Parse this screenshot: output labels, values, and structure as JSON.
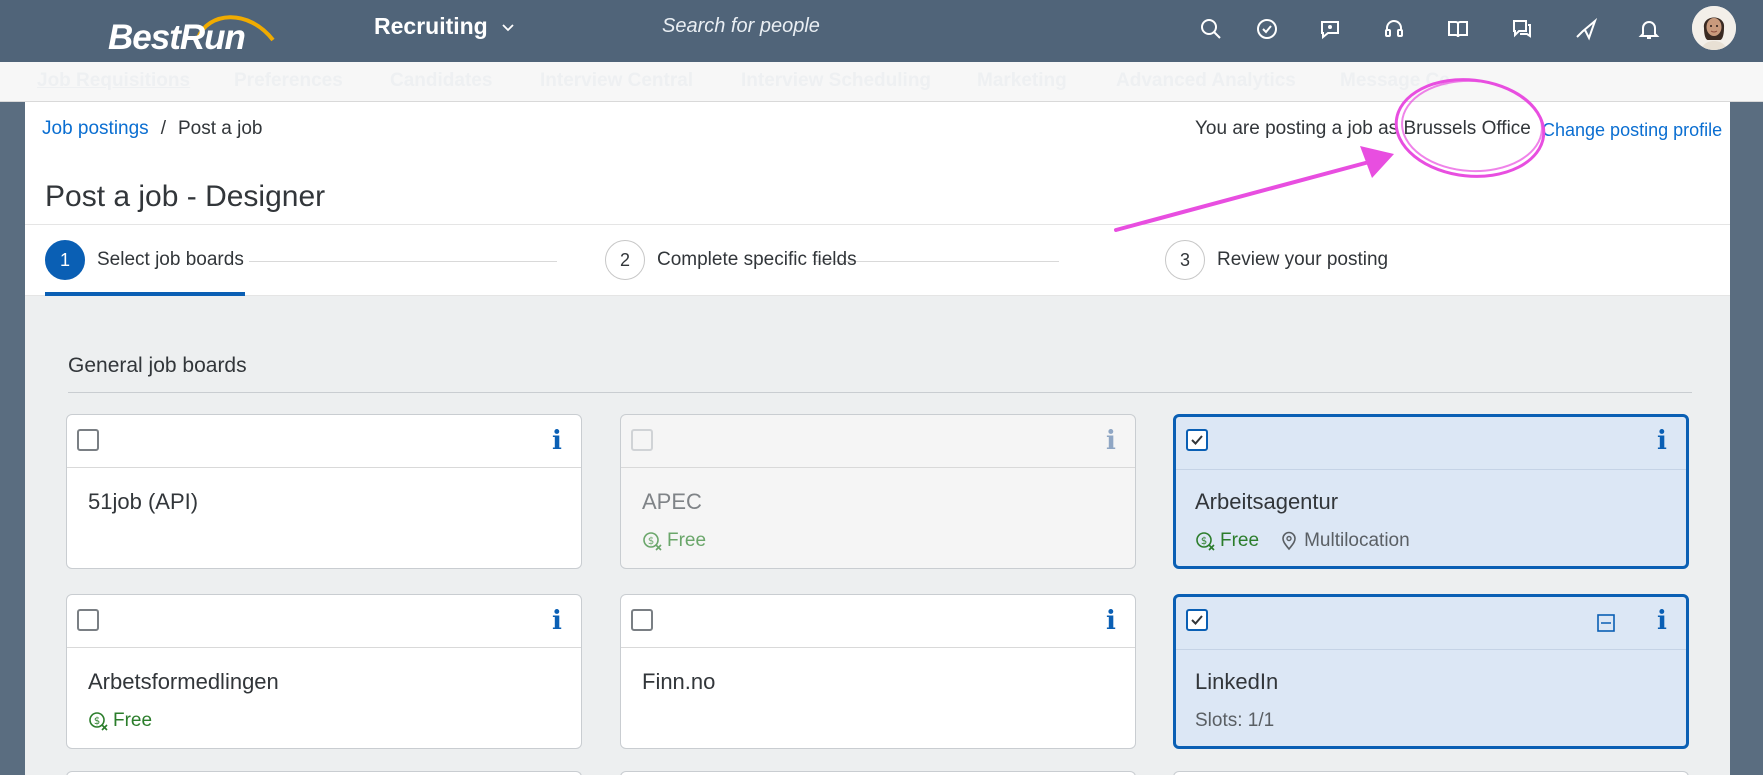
{
  "shell": {
    "logo_text": "BestRun",
    "product_name": "Recruiting",
    "search_placeholder": "Search for people",
    "icons": [
      "search-icon",
      "checkmark-circle-icon",
      "chat-icon",
      "headset-icon",
      "book-icon",
      "feedback-icon",
      "paper-plane-icon",
      "bell-icon"
    ]
  },
  "nav": {
    "items": [
      "Job Requisitions",
      "Preferences",
      "Candidates",
      "Interview Central",
      "Interview Scheduling",
      "Marketing",
      "Advanced Analytics",
      "Message Ce"
    ]
  },
  "breadcrumb": {
    "parent": "Job postings",
    "separator": "/",
    "current": "Post a job"
  },
  "posting_profile": {
    "text": "You are posting a job as Brussels Office",
    "change_label": "Change posting profile"
  },
  "page_title": "Post a job - Designer",
  "wizard": {
    "steps": [
      {
        "number": "1",
        "label": "Select job boards",
        "active": true
      },
      {
        "number": "2",
        "label": "Complete specific fields",
        "active": false
      },
      {
        "number": "3",
        "label": "Review your posting",
        "active": false
      }
    ]
  },
  "section": {
    "title": "General job boards"
  },
  "boards": [
    {
      "name": "51job (API)",
      "checked": false,
      "disabled": false
    },
    {
      "name": "APEC",
      "free": "Free",
      "checked": false,
      "disabled": true
    },
    {
      "name": "Arbeitsagentur",
      "free": "Free",
      "location": "Multilocation",
      "checked": true,
      "disabled": false
    },
    {
      "name": "Arbetsformedlingen",
      "free": "Free",
      "checked": false,
      "disabled": false
    },
    {
      "name": "Finn.no",
      "checked": false,
      "disabled": false
    },
    {
      "name": "LinkedIn",
      "slots": "Slots: 1/1",
      "checked": true,
      "disabled": false
    }
  ],
  "colors": {
    "shell": "#506479",
    "accent": "#0a5fb4",
    "free_green": "#2b7d2b",
    "annotation": "#e84ee0"
  }
}
